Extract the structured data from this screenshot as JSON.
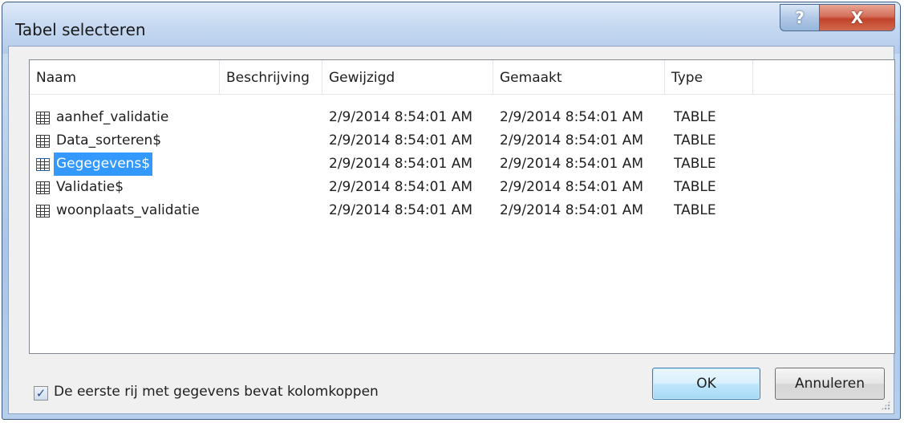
{
  "window": {
    "title": "Tabel selecteren",
    "help_label": "?",
    "close_label": "X"
  },
  "list": {
    "columns": [
      "Naam",
      "Beschrijving",
      "Gewijzigd",
      "Gemaakt",
      "Type"
    ],
    "rows": [
      {
        "name": "aanhef_validatie",
        "description": "",
        "modified": "2/9/2014 8:54:01 AM",
        "created": "2/9/2014 8:54:01 AM",
        "type": "TABLE",
        "selected": false
      },
      {
        "name": "Data_sorteren$",
        "description": "",
        "modified": "2/9/2014 8:54:01 AM",
        "created": "2/9/2014 8:54:01 AM",
        "type": "TABLE",
        "selected": false
      },
      {
        "name": "Gegegevens$",
        "description": "",
        "modified": "2/9/2014 8:54:01 AM",
        "created": "2/9/2014 8:54:01 AM",
        "type": "TABLE",
        "selected": true
      },
      {
        "name": "Validatie$",
        "description": "",
        "modified": "2/9/2014 8:54:01 AM",
        "created": "2/9/2014 8:54:01 AM",
        "type": "TABLE",
        "selected": false
      },
      {
        "name": "woonplaats_validatie",
        "description": "",
        "modified": "2/9/2014 8:54:01 AM",
        "created": "2/9/2014 8:54:01 AM",
        "type": "TABLE",
        "selected": false
      }
    ],
    "row_icon": "table-icon",
    "selection_color": "#3399ff"
  },
  "options": {
    "header_checkbox_label": "De eerste rij met gegevens bevat kolomkoppen",
    "header_checkbox_checked": true
  },
  "buttons": {
    "ok_label": "OK",
    "cancel_label": "Annuleren"
  }
}
